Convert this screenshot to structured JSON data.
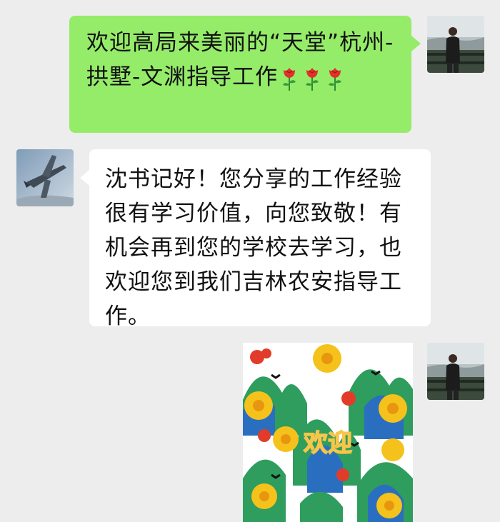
{
  "chat": {
    "messages": [
      {
        "side": "out",
        "text": "欢迎高局来美丽的“天堂”杭州-拱墅-文渊指导工作",
        "emoji": [
          "rose-emoji",
          "rose-emoji",
          "rose-emoji"
        ]
      },
      {
        "side": "in",
        "text": "沈书记好！您分享的工作经验很有学习价值，向您致敬！有机会再到您的学校去学习，也欢迎您到我们吉林农安指导工作。"
      },
      {
        "side": "out",
        "type": "sticker",
        "sticker_text": "欢迎"
      }
    ]
  },
  "colors": {
    "background": "#ededed",
    "outgoing_bubble": "#95ec69",
    "incoming_bubble": "#ffffff"
  }
}
